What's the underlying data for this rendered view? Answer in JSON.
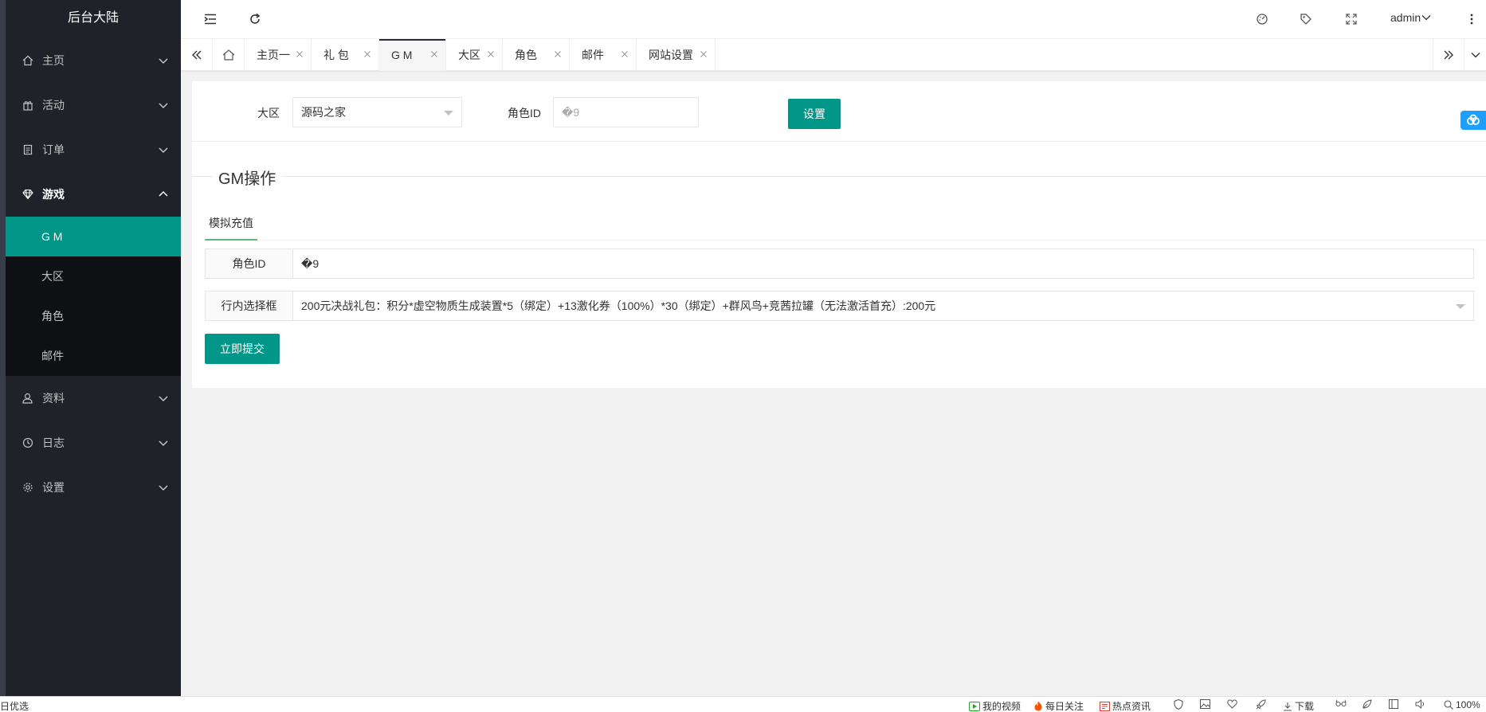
{
  "app": {
    "title": "后台大陆"
  },
  "sidebar": {
    "items": [
      {
        "label": "主页",
        "icon": "home-icon"
      },
      {
        "label": "活动",
        "icon": "gift-icon"
      },
      {
        "label": "订单",
        "icon": "clipboard-icon"
      },
      {
        "label": "游戏",
        "icon": "diamond-icon",
        "expanded": true,
        "children": [
          "G M",
          "大区",
          "角色",
          "邮件"
        ],
        "selected": "G M"
      },
      {
        "label": "资料",
        "icon": "user-icon"
      },
      {
        "label": "日志",
        "icon": "clock-icon"
      },
      {
        "label": "设置",
        "icon": "gear-icon"
      }
    ]
  },
  "header": {
    "user": "admin"
  },
  "tabs": {
    "items": [
      "主页一",
      "礼 包",
      "G M",
      "大区",
      "角色",
      "邮件",
      "网站设置"
    ],
    "active": "G M"
  },
  "filter": {
    "region_label": "大区",
    "region_value": "源码之家",
    "role_label": "角色ID",
    "role_placeholder": "�9",
    "set_button": "设置"
  },
  "gm": {
    "title": "GM操作",
    "subtab": "模拟充值",
    "role_label": "角色ID",
    "role_value": "�9",
    "select_label": "行内选择框",
    "select_value": "200元决战礼包：积分*虚空物质生成装置*5（绑定）+13激化券（100%）*30（绑定）+群风鸟+竞茜拉罐（无法激活首充）:200元",
    "submit": "立即提交"
  },
  "statusbar": {
    "left": "日优选",
    "my_videos": "我的视频",
    "daily_follow": "每日关注",
    "hot_news": "热点资讯",
    "download": "下载",
    "zoom": "100%"
  },
  "colors": {
    "accent": "#009688",
    "sidebar": "#20222a",
    "submenu": "#0f1014"
  }
}
